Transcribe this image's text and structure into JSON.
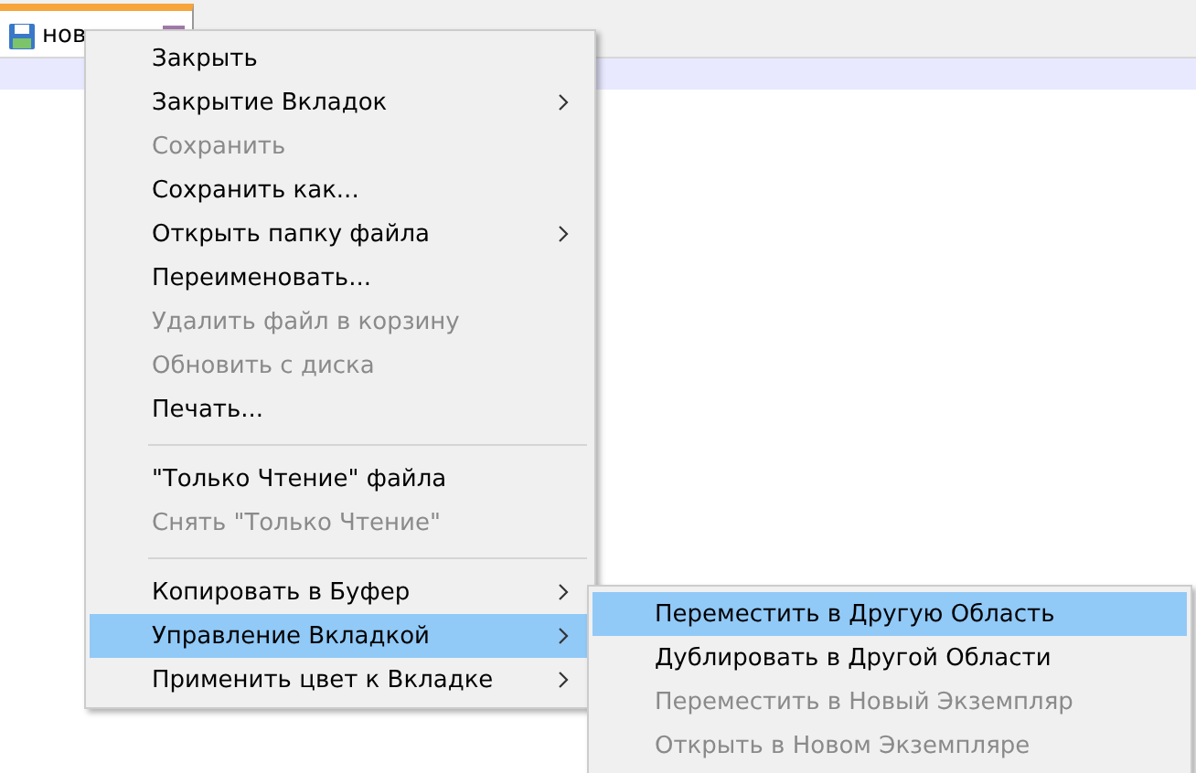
{
  "tab": {
    "title": "нов",
    "selected": true
  },
  "context_menu": {
    "items": [
      {
        "kind": "item",
        "label": "Закрыть",
        "disabled": false,
        "submenu": false,
        "selected": false
      },
      {
        "kind": "item",
        "label": "Закрытие Вкладок",
        "disabled": false,
        "submenu": true,
        "selected": false
      },
      {
        "kind": "item",
        "label": "Сохранить",
        "disabled": true,
        "submenu": false,
        "selected": false
      },
      {
        "kind": "item",
        "label": "Сохранить как...",
        "disabled": false,
        "submenu": false,
        "selected": false
      },
      {
        "kind": "item",
        "label": "Открыть папку файла",
        "disabled": false,
        "submenu": true,
        "selected": false
      },
      {
        "kind": "item",
        "label": "Переименовать...",
        "disabled": false,
        "submenu": false,
        "selected": false
      },
      {
        "kind": "item",
        "label": "Удалить файл в корзину",
        "disabled": true,
        "submenu": false,
        "selected": false
      },
      {
        "kind": "item",
        "label": "Обновить с диска",
        "disabled": true,
        "submenu": false,
        "selected": false
      },
      {
        "kind": "item",
        "label": "Печать...",
        "disabled": false,
        "submenu": false,
        "selected": false
      },
      {
        "kind": "separator"
      },
      {
        "kind": "item",
        "label": "\"Только Чтение\" файла",
        "disabled": false,
        "submenu": false,
        "selected": false
      },
      {
        "kind": "item",
        "label": "Снять \"Только Чтение\"",
        "disabled": true,
        "submenu": false,
        "selected": false
      },
      {
        "kind": "separator"
      },
      {
        "kind": "item",
        "label": "Копировать в Буфер",
        "disabled": false,
        "submenu": true,
        "selected": false
      },
      {
        "kind": "item",
        "label": "Управление Вкладкой",
        "disabled": false,
        "submenu": true,
        "selected": true
      },
      {
        "kind": "item",
        "label": "Применить цвет к Вкладке",
        "disabled": false,
        "submenu": true,
        "selected": false
      }
    ]
  },
  "submenu": {
    "items": [
      {
        "label": "Переместить в Другую Область",
        "disabled": false,
        "selected": true
      },
      {
        "label": "Дублировать в Другой Области",
        "disabled": false,
        "selected": false
      },
      {
        "label": "Переместить в Новый Экземпляр",
        "disabled": true,
        "selected": false
      },
      {
        "label": "Открыть в Новом Экземпляре",
        "disabled": true,
        "selected": false
      }
    ]
  }
}
